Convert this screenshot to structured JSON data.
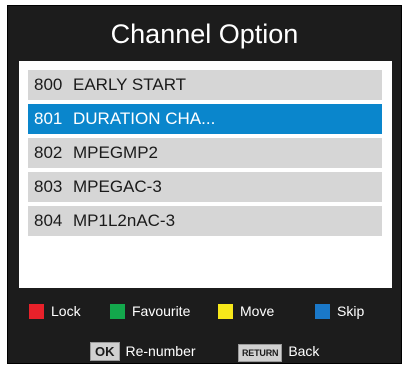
{
  "menu": {
    "title": "Channel Option"
  },
  "channels": [
    {
      "number": "800",
      "name": "EARLY START",
      "selected": false
    },
    {
      "number": "801",
      "name": "DURATION CHA...",
      "selected": true
    },
    {
      "number": "802",
      "name": "MPEGMP2",
      "selected": false
    },
    {
      "number": "803",
      "name": "MPEGAC-3",
      "selected": false
    },
    {
      "number": "804",
      "name": "MP1L2nAC-3",
      "selected": false
    }
  ],
  "legend": [
    {
      "label": "Lock",
      "color": "#e8212a"
    },
    {
      "label": "Favourite",
      "color": "#13a84c"
    },
    {
      "label": "Move",
      "color": "#f7e81a"
    },
    {
      "label": "Skip",
      "color": "#1a78c8"
    }
  ],
  "bottom_keys": [
    {
      "key": "OK",
      "label": "Re-number"
    },
    {
      "key": "RETURN",
      "label": "Back"
    }
  ],
  "colors": {
    "background": "#1c1c1c",
    "selected_row": "#0a86cc",
    "row": "#d6d6d6"
  }
}
